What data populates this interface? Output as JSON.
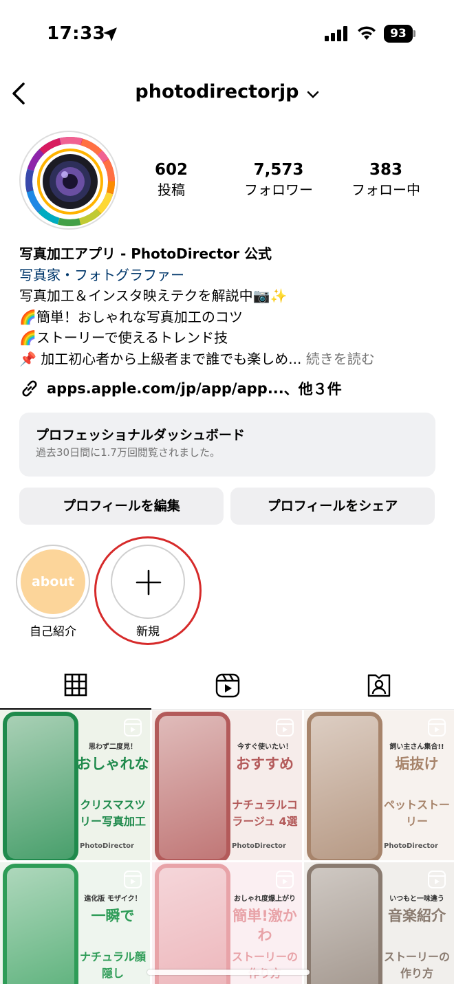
{
  "status_bar": {
    "time": "17:33",
    "battery": "93"
  },
  "header": {
    "username": "photodirectorjp"
  },
  "stats": [
    {
      "num": "602",
      "label": "投稿"
    },
    {
      "num": "7,573",
      "label": "フォロワー"
    },
    {
      "num": "383",
      "label": "フォロー中"
    }
  ],
  "bio": {
    "name": "写真加工アプリ - PhotoDirector 公式",
    "category": "写真家・フォトグラファー",
    "line1": "写真加工＆インスタ映えテクを解説中📷✨",
    "line2": "🌈簡単！おしゃれな写真加工のコツ",
    "line3": "🌈ストーリーで使えるトレンド技",
    "line4": "📌 加工初心者から上級者まで誰でも楽しめ...",
    "more": "続きを読む",
    "link": "apps.apple.com/jp/app/app...",
    "link_suffix": "、他３件"
  },
  "dashboard": {
    "title": "プロフェッショナルダッシュボード",
    "subtitle": "過去30日間に1.7万回閲覧されました。"
  },
  "buttons": {
    "edit": "プロフィールを編集",
    "share": "プロフィールをシェア"
  },
  "highlights": [
    {
      "inner": "about",
      "label": "自己紹介"
    },
    {
      "label": "新規"
    }
  ],
  "posts": [
    {
      "small": "思わず二度見！",
      "big": "おしゃれな",
      "mid": "クリスマスツリー写真加工",
      "brand": "PhotoDirector",
      "accent": "#1f8a4c",
      "bg": "#eef3ea"
    },
    {
      "small": "今すぐ使いたい！",
      "big": "おすすめ",
      "mid": "ナチュラルコラージュ 4選",
      "brand": "PhotoDirector",
      "accent": "#b35a5a",
      "bg": "#f6ecea"
    },
    {
      "small": "飼い主さん集合!!",
      "big": "垢抜け",
      "mid": "ペットストーリー",
      "brand": "PhotoDirector",
      "accent": "#a7846b",
      "bg": "#f7f2ee"
    },
    {
      "small": "進化版 モザイク！",
      "big": "一瞬で",
      "mid": "ナチュラル顔隠し",
      "brand": "",
      "accent": "#2e9c57",
      "bg": "#eef5ee"
    },
    {
      "small": "おしゃれ度爆上がり",
      "big": "簡単!激かわ",
      "mid": "ストーリーの作り方",
      "brand": "",
      "accent": "#e8a3a8",
      "bg": "#fbeff2"
    },
    {
      "small": "いつもと一味違う",
      "big": "音楽紹介",
      "mid": "ストーリーの作り方",
      "brand": "",
      "accent": "#8a7b70",
      "bg": "#f1efec"
    }
  ]
}
